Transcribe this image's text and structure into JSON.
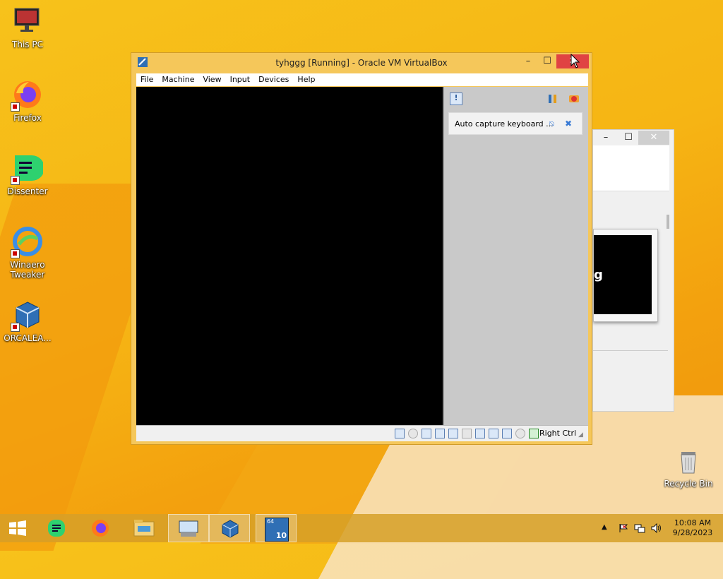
{
  "desktop": {
    "icons": [
      {
        "label": "This PC",
        "icon": "monitor-icon"
      },
      {
        "label": "Firefox",
        "icon": "firefox-icon"
      },
      {
        "label": "Dissenter",
        "icon": "dissenter-icon"
      },
      {
        "label": "Winaero Tweaker",
        "icon": "winaero-icon"
      },
      {
        "label": "ORCALEA...",
        "icon": "virtualbox-icon"
      },
      {
        "label": "Recycle Bin",
        "icon": "recycle-bin-icon"
      }
    ]
  },
  "vbox": {
    "title": "tyhggg [Running] - Oracle VM VirtualBox",
    "menu": [
      "File",
      "Machine",
      "View",
      "Input",
      "Devices",
      "Help"
    ],
    "notification": "Auto capture keyboard ...",
    "host_key": "Right Ctrl"
  },
  "bgwin": {
    "partial_text": "g"
  },
  "taskbar": {
    "time": "10:08 AM",
    "date": "9/28/2023",
    "vbox_badge": "10",
    "vbox_badge_top": "64"
  },
  "colors": {
    "accent": "#f6b514",
    "close": "#e04343"
  }
}
